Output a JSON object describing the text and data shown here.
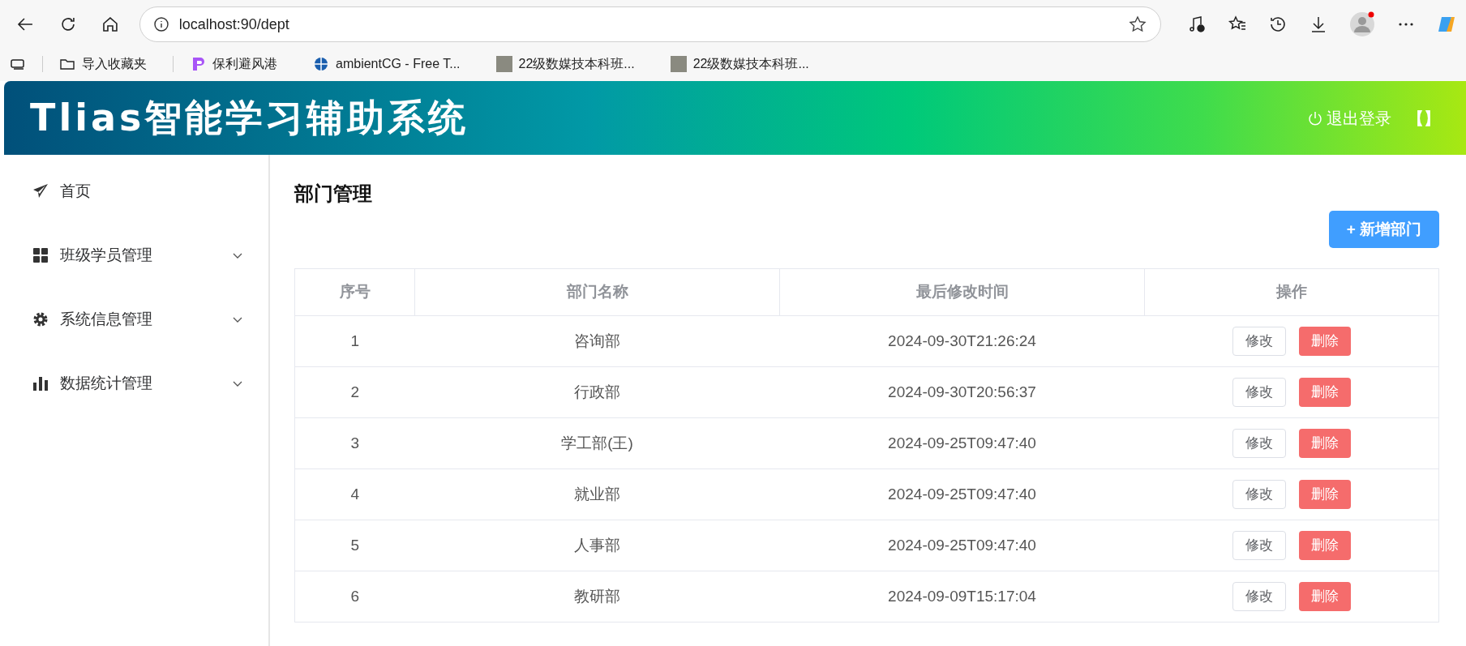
{
  "browser": {
    "url": "localhost:90/dept",
    "bookmarks": [
      {
        "kind": "import",
        "label": "导入收藏夹"
      },
      {
        "kind": "app",
        "label": "保利避风港"
      },
      {
        "kind": "globe",
        "label": "ambientCG - Free T..."
      },
      {
        "kind": "photo",
        "label": "22级数媒技本科班..."
      },
      {
        "kind": "photo",
        "label": "22级数媒技本科班..."
      }
    ]
  },
  "header": {
    "title": "Tlias智能学习辅助系统",
    "logout": "退出登录",
    "bracket": "【】"
  },
  "sidebar": {
    "items": [
      {
        "label": "首页",
        "kind": "link"
      },
      {
        "label": "班级学员管理",
        "kind": "group"
      },
      {
        "label": "系统信息管理",
        "kind": "group"
      },
      {
        "label": "数据统计管理",
        "kind": "group"
      }
    ]
  },
  "page": {
    "title": "部门管理",
    "add_button": "+ 新增部门"
  },
  "table": {
    "columns": [
      "序号",
      "部门名称",
      "最后修改时间",
      "操作"
    ],
    "rows": [
      {
        "index": "1",
        "name": "咨询部",
        "updated": "2024-09-30T21:26:24",
        "actions": [
          "修改",
          "删除"
        ]
      },
      {
        "index": "2",
        "name": "行政部",
        "updated": "2024-09-30T20:56:37",
        "actions": [
          "修改",
          "删除"
        ]
      },
      {
        "index": "3",
        "name": "学工部(王)",
        "updated": "2024-09-25T09:47:40",
        "actions": [
          "修改",
          "删除"
        ]
      },
      {
        "index": "4",
        "name": "就业部",
        "updated": "2024-09-25T09:47:40",
        "actions": [
          "修改",
          "删除"
        ]
      },
      {
        "index": "5",
        "name": "人事部",
        "updated": "2024-09-25T09:47:40",
        "actions": [
          "修改",
          "删除"
        ]
      },
      {
        "index": "6",
        "name": "教研部",
        "updated": "2024-09-09T15:17:04",
        "actions": [
          "修改",
          "删除"
        ]
      }
    ]
  }
}
